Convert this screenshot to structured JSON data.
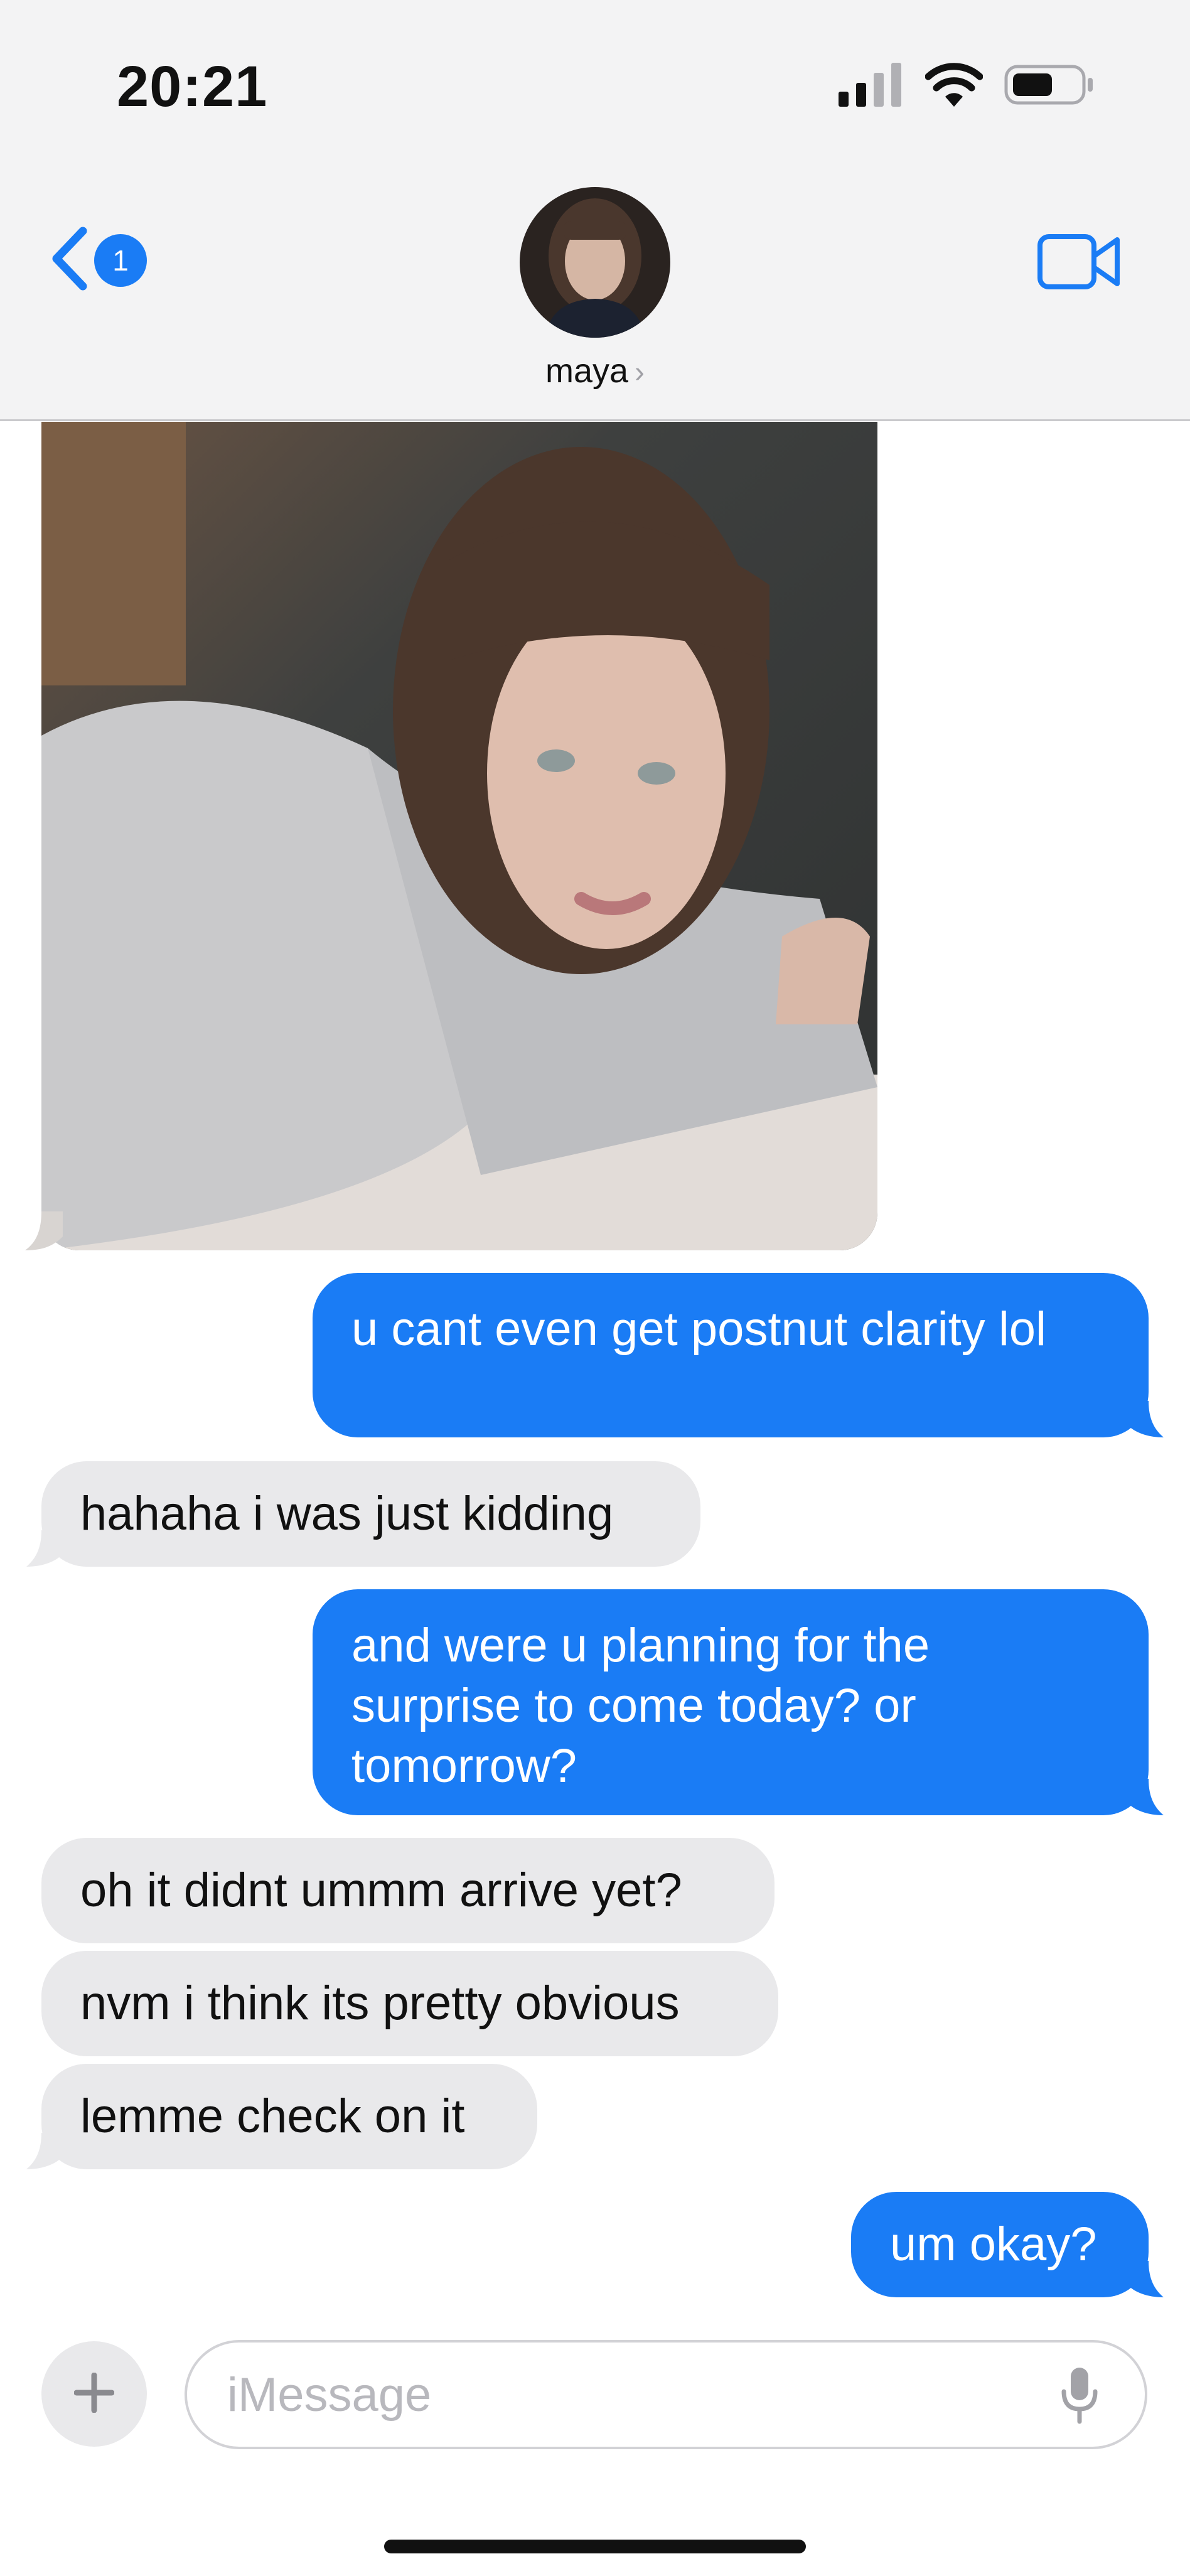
{
  "status_bar": {
    "time": "20:21"
  },
  "header": {
    "back_badge": "1",
    "contact_name": "maya",
    "name_chevron": "›"
  },
  "messages": [
    {
      "dir": "in",
      "type": "image"
    },
    {
      "dir": "out",
      "text": "u cant even get postnut clarity lol"
    },
    {
      "dir": "in",
      "text": "hahaha i was just kidding"
    },
    {
      "dir": "out",
      "text": "and were u planning for the surprise to come today? or tomorrow?"
    },
    {
      "dir": "in",
      "text": "oh it didnt ummm arrive yet?"
    },
    {
      "dir": "in",
      "text": "nvm i think its pretty obvious"
    },
    {
      "dir": "in",
      "text": "lemme check on it"
    },
    {
      "dir": "out",
      "text": "um okay?"
    }
  ],
  "composer": {
    "placeholder": "iMessage"
  },
  "colors": {
    "accent": "#1a7cf5",
    "incoming_bubble": "#e9e9eb",
    "header_bg": "#f3f3f4"
  },
  "icons": [
    "cellular-signal-icon",
    "wifi-icon",
    "battery-icon",
    "back-chevron-icon",
    "video-call-icon",
    "plus-icon",
    "microphone-icon"
  ]
}
